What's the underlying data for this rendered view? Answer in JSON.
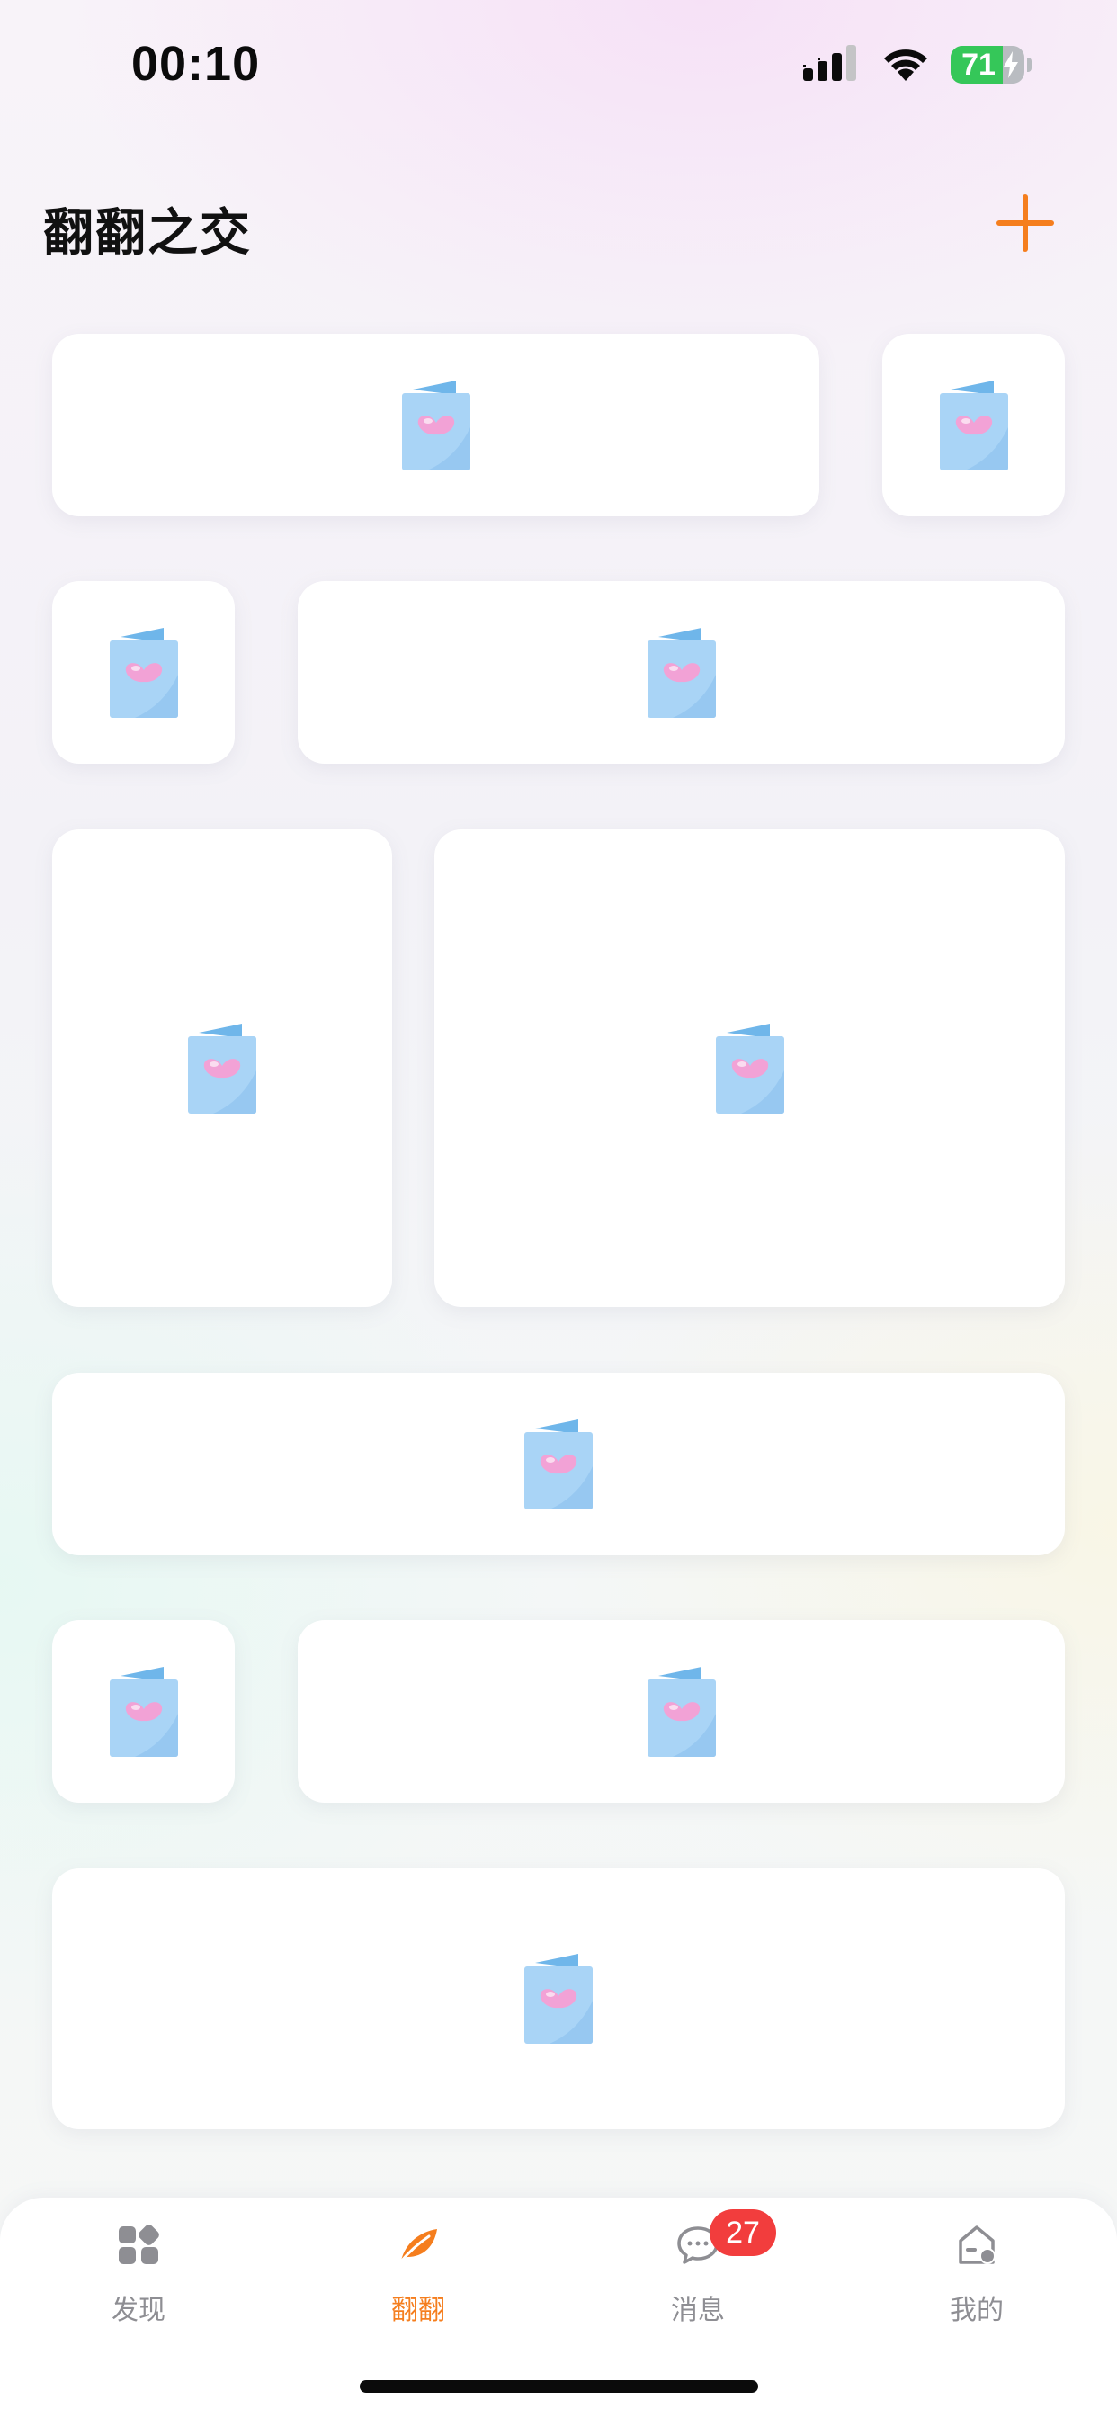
{
  "status_bar": {
    "time": "00:10",
    "battery_level": "71",
    "battery_fraction": 0.71,
    "battery_charging": true,
    "signal_icon": "cellular-signal-icon",
    "wifi_icon": "wifi-icon"
  },
  "header": {
    "title": "翻翻之交",
    "add_icon": "plus-icon"
  },
  "cards": [
    {
      "icon": "greeting-card-heart-icon"
    },
    {
      "icon": "greeting-card-heart-icon"
    },
    {
      "icon": "greeting-card-heart-icon"
    },
    {
      "icon": "greeting-card-heart-icon"
    },
    {
      "icon": "greeting-card-heart-icon"
    },
    {
      "icon": "greeting-card-heart-icon"
    },
    {
      "icon": "greeting-card-heart-icon"
    },
    {
      "icon": "greeting-card-heart-icon"
    },
    {
      "icon": "greeting-card-heart-icon"
    },
    {
      "icon": "greeting-card-heart-icon"
    }
  ],
  "tab_bar": {
    "tabs": [
      {
        "label": "发现",
        "icon": "discover-grid-icon",
        "active": false
      },
      {
        "label": "翻翻",
        "icon": "leaf-icon",
        "active": true
      },
      {
        "label": "消息",
        "icon": "chat-bubble-icon",
        "active": false
      },
      {
        "label": "我的",
        "icon": "home-profile-icon",
        "active": false
      }
    ],
    "message_badge": "27"
  },
  "colors": {
    "accent": "#f57e1e",
    "badge": "#f23d3d",
    "battery": "#35c759",
    "inactive": "#8e8e93",
    "card_icon_blue": "#a9d4f6",
    "card_icon_heart": "#f3a6d8"
  }
}
